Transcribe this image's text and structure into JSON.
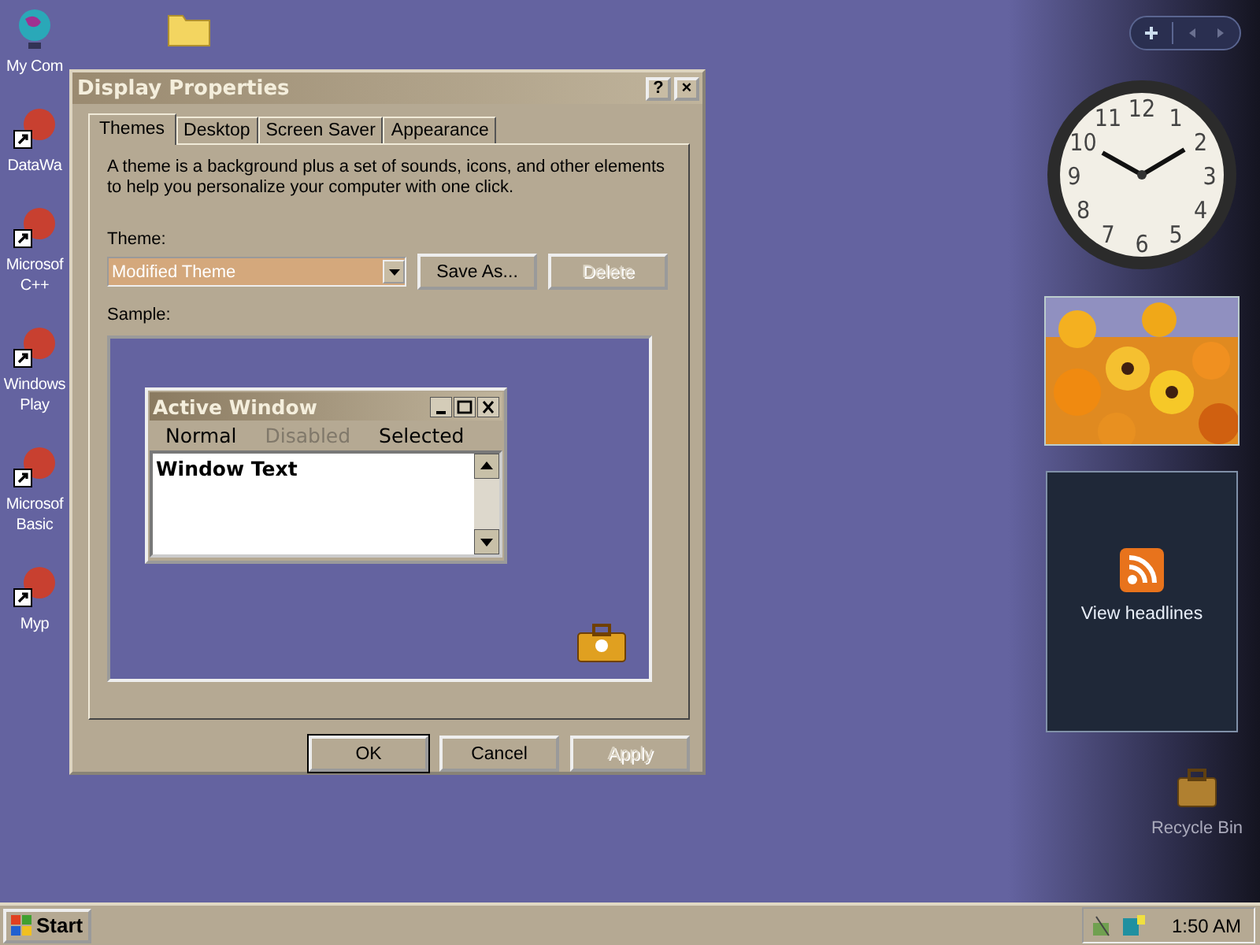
{
  "desktop_icons": [
    {
      "kind": "globe",
      "lines": [
        "My Com"
      ]
    },
    {
      "kind": "shortcut",
      "lines": [
        "DataWa"
      ]
    },
    {
      "kind": "shortcut",
      "lines": [
        "Microsof",
        "C++"
      ]
    },
    {
      "kind": "shortcut",
      "lines": [
        "Windows",
        "Play"
      ]
    },
    {
      "kind": "shortcut",
      "lines": [
        "Microsof",
        "Basic"
      ]
    },
    {
      "kind": "shortcut",
      "lines": [
        "Myp"
      ]
    }
  ],
  "dialog": {
    "title": "Display Properties",
    "title_buttons": [
      "?",
      "×"
    ],
    "tabs": [
      {
        "label": "Themes",
        "selected": true
      },
      {
        "label": "Desktop",
        "selected": false
      },
      {
        "label": "Screen Saver",
        "selected": false
      },
      {
        "label": "Appearance",
        "selected": false
      }
    ],
    "description": "A theme is a background plus a set of sounds, icons, and other elements to help you personalize your computer with one click.",
    "theme_label": "Theme:",
    "theme_value": "Modified Theme",
    "theme_buttons": [
      {
        "label": "Save As...",
        "disabled": false
      },
      {
        "label": "Delete",
        "disabled": true
      }
    ],
    "sample_label": "Sample:",
    "sample": {
      "title": "Active Window",
      "menu": [
        {
          "label": "Normal",
          "disabled": false
        },
        {
          "label": "Disabled",
          "disabled": true
        },
        {
          "label": "Selected",
          "disabled": false
        }
      ],
      "window_text": "Window Text"
    },
    "buttons": [
      {
        "label": "OK",
        "disabled": false,
        "default": true
      },
      {
        "label": "Cancel",
        "disabled": false,
        "default": false
      },
      {
        "label": "Apply",
        "disabled": true,
        "default": false
      }
    ]
  },
  "sidebar": {
    "clock_numerals": [
      "11",
      "12",
      "1",
      "10",
      "2",
      "9",
      "3",
      "8",
      "4",
      "7",
      "6",
      "5"
    ],
    "headlines": "View headlines"
  },
  "recycle_bin": "Recycle Bin",
  "taskbar": {
    "start": "Start",
    "time": "1:50 AM"
  }
}
